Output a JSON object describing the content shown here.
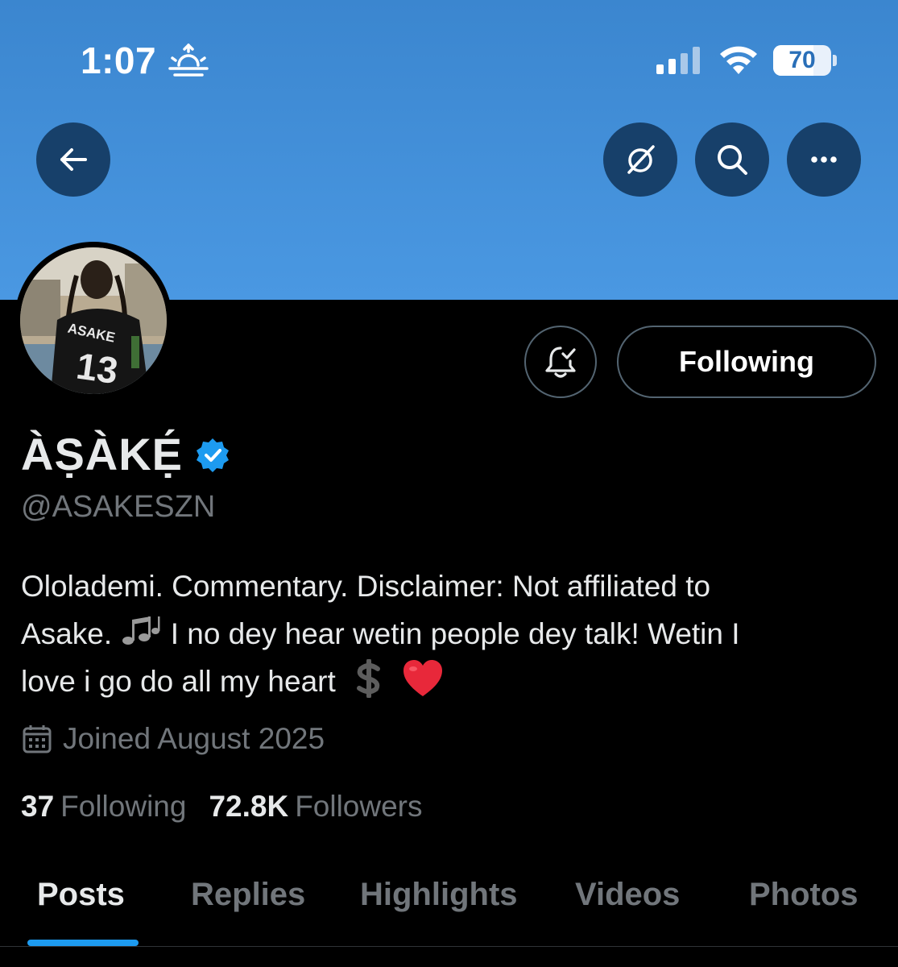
{
  "status_bar": {
    "time": "1:07",
    "battery": "70",
    "battery_level_percent": 70
  },
  "header": {
    "back_icon": "arrow-left-icon",
    "grok_icon": "grok-icon",
    "search_icon": "search-icon",
    "more_icon": "more-horizontal-icon"
  },
  "profile": {
    "display_name": "ÀṢÀKẸ́",
    "handle": "@ASAKESZN",
    "follow_button": "Following",
    "bio": {
      "line1": "Ololademi. Commentary. Disclaimer: Not affiliated to",
      "line2a": "Asake.",
      "line2b": "I no dey hear wetin people dey talk! Wetin I",
      "line3": "love i go do all my heart"
    },
    "joined": "Joined August 2025",
    "stats": {
      "following_count": "37",
      "following_label": "Following",
      "followers_count": "72.8K",
      "followers_label": "Followers"
    }
  },
  "tabs": [
    "Posts",
    "Replies",
    "Highlights",
    "Videos",
    "Photos"
  ],
  "colors": {
    "banner": "#4a98e2",
    "accent": "#1d9bf0",
    "muted": "#71767b"
  }
}
